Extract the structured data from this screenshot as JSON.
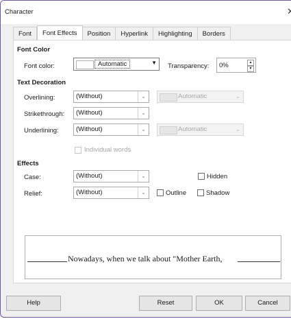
{
  "window": {
    "title": "Character",
    "close_glyph": "✕"
  },
  "tabs": [
    "Font",
    "Font Effects",
    "Position",
    "Hyperlink",
    "Highlighting",
    "Borders"
  ],
  "active_tab": "Font Effects",
  "font_color": {
    "header": "Font Color",
    "font_color_label": "Font color:",
    "font_color_value": "Automatic",
    "transparency_label": "Transparency:",
    "transparency_value": "0%"
  },
  "text_decoration": {
    "header": "Text Decoration",
    "overlining_label": "Overlining:",
    "overlining_value": "(Without)",
    "overlining_color": "Automatic",
    "strikethrough_label": "Strikethrough:",
    "strikethrough_value": "(Without)",
    "underlining_label": "Underlining:",
    "underlining_value": "(Without)",
    "underlining_color": "Automatic",
    "individual_words_label": "Individual words"
  },
  "effects": {
    "header": "Effects",
    "case_label": "Case:",
    "case_value": "(Without)",
    "relief_label": "Relief:",
    "relief_value": "(Without)",
    "hidden_label": "Hidden",
    "outline_label": "Outline",
    "shadow_label": "Shadow"
  },
  "preview": {
    "text": "Nowadays, when we talk about \"Mother Earth,"
  },
  "buttons": {
    "help": "Help",
    "reset": "Reset",
    "ok": "OK",
    "cancel": "Cancel"
  },
  "icons": {
    "dropdown": "chevron-down-icon",
    "spin": "spin-arrows-icon",
    "close": "close-icon"
  },
  "colors": {
    "accent_border": "#6e56a3",
    "dialog_bg": "#f0f0f0",
    "panel_bg": "#ffffff"
  }
}
